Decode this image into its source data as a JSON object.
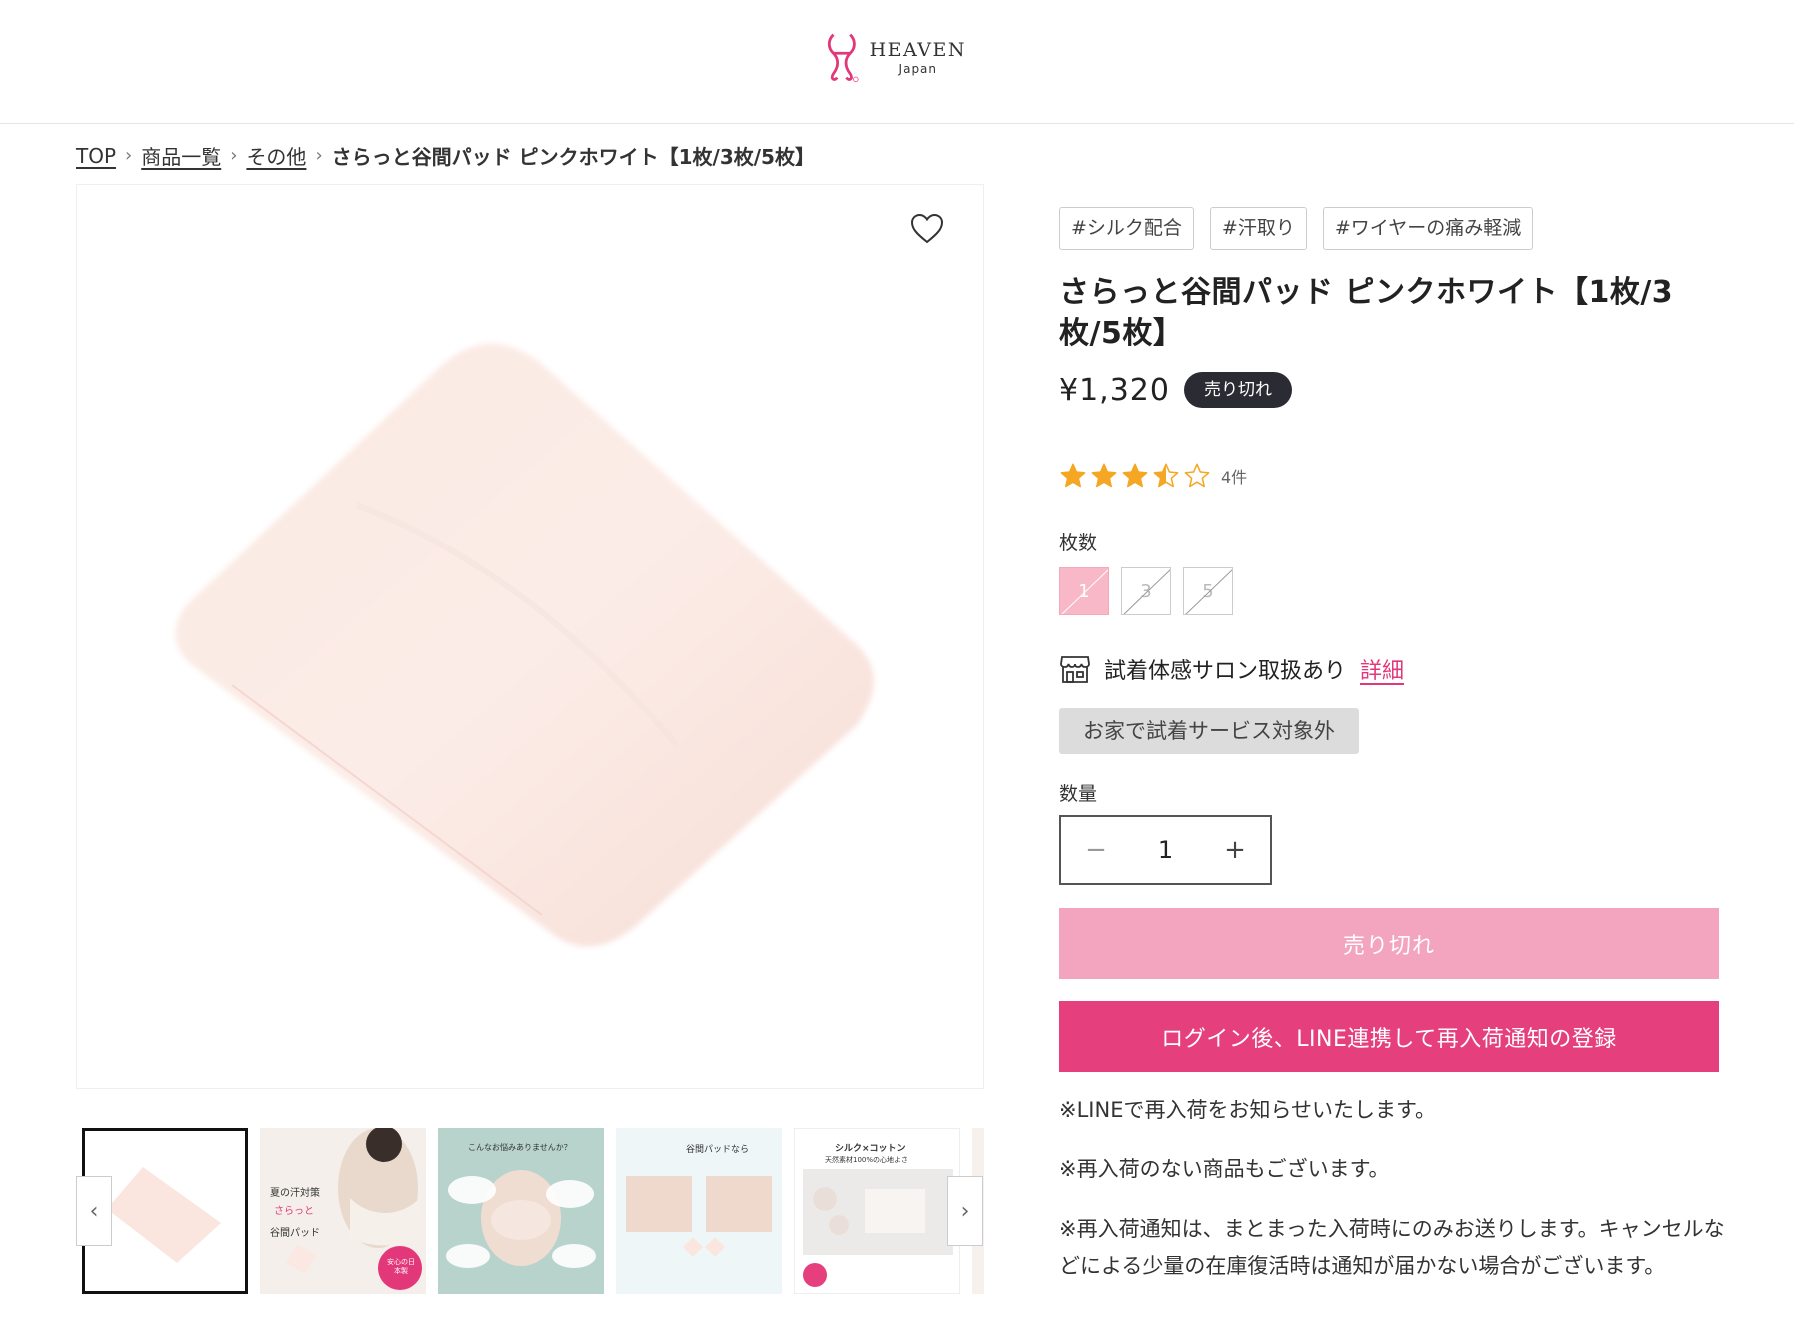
{
  "header": {
    "logo_name": "HEAVEN",
    "logo_sub": "Japan"
  },
  "breadcrumb": {
    "items": [
      "TOP",
      "商品一覧",
      "その他"
    ],
    "current": "さらっと谷間パッド ピンクホワイト【1枚/3枚/5枚】"
  },
  "product": {
    "tags": [
      "#シルク配合",
      "#汗取り",
      "#ワイヤーの痛み軽減"
    ],
    "title": "さらっと谷間パッド ピンクホワイト【1枚/3枚/5枚】",
    "price": "¥1,320",
    "badge": "売り切れ",
    "rating": {
      "value": 3.5,
      "max": 5,
      "count_text": "4件",
      "star_color": "#f5a623"
    },
    "option_label": "枚数",
    "options": [
      "1",
      "3",
      "5"
    ],
    "selected_option": "1",
    "salon_text": "試着体感サロン取扱あり",
    "salon_link": "詳細",
    "home_try_text": "お家で試着サービス対象外",
    "quantity_label": "数量",
    "quantity_value": "1",
    "soldout_button": "売り切れ",
    "line_button": "ログイン後、LINE連携して再入荷通知の登録",
    "notes": [
      "※LINEで再入荷をお知らせいたします。",
      "※再入荷のない商品もございます。",
      "※再入荷通知は、まとまった入荷時にのみお送りします。キャンセルなどによる少量の在庫復活時は通知が届かない場合がございます。"
    ]
  },
  "gallery": {
    "thumbs": [
      {
        "name": "thumb-pad-photo"
      },
      {
        "name": "thumb-summer-sweat",
        "text": [
          "夏の汗対策",
          "さらっと",
          "谷間パッド",
          "安心の日本製"
        ]
      },
      {
        "name": "thumb-worries",
        "text": [
          "こんなお悩みありませんか？"
        ]
      },
      {
        "name": "thumb-usage",
        "text": [
          "谷間パッドなら"
        ]
      },
      {
        "name": "thumb-silk-cotton",
        "text": [
          "シルク×コットン",
          "天然素材100%の心地よさ"
        ]
      }
    ],
    "prev_icon": "chevron-left-icon",
    "next_icon": "chevron-right-icon"
  },
  "colors": {
    "accent_pink": "#e5407d",
    "soldout_pink": "#f3a4bf",
    "logo_pink": "#e2387a"
  }
}
